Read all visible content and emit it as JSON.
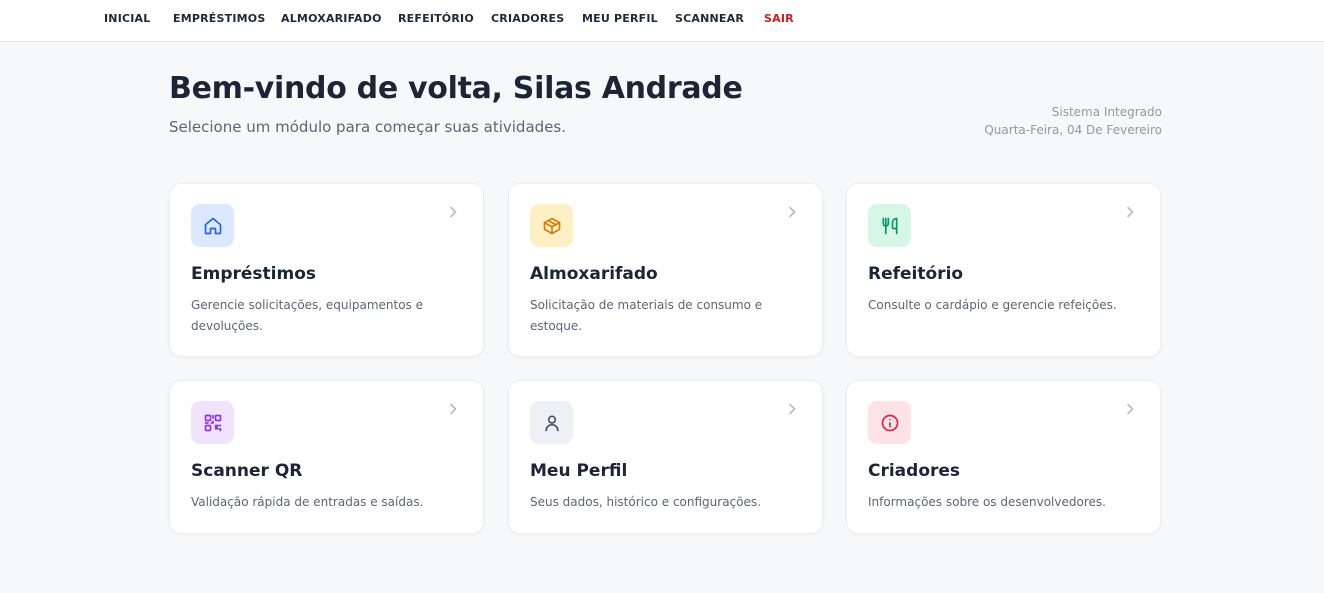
{
  "nav": {
    "items": [
      {
        "label": "INICIAL"
      },
      {
        "label": "EMPRÉSTIMOS"
      },
      {
        "label": "ALMOXARIFADO"
      },
      {
        "label": "REFEITÓRIO"
      },
      {
        "label": "CRIADORES"
      },
      {
        "label": "MEU PERFIL"
      },
      {
        "label": "SCANNEAR"
      }
    ],
    "logout_label": "SAIR",
    "logout_color": "#c81e1e"
  },
  "header": {
    "greeting": "Bem-vindo de volta, Silas Andrade",
    "subtitle": "Selecione um módulo para começar suas atividades.",
    "system_name": "Sistema Integrado",
    "date": "Quarta-Feira, 04 De Fevereiro"
  },
  "modules": [
    {
      "title": "Empréstimos",
      "description": "Gerencie solicitações, equipamentos e devoluções.",
      "icon": "home-icon",
      "icon_bg": "#dbe8fe",
      "icon_color": "#2563eb"
    },
    {
      "title": "Almoxarifado",
      "description": "Solicitação de materiais de consumo e estoque.",
      "icon": "package-icon",
      "icon_bg": "#fdf0c4",
      "icon_color": "#d97706"
    },
    {
      "title": "Refeitório",
      "description": "Consulte o cardápio e gerencie refeições.",
      "icon": "utensils-icon",
      "icon_bg": "#d6f7e5",
      "icon_color": "#059669"
    },
    {
      "title": "Scanner QR",
      "description": "Validação rápida de entradas e saídas.",
      "icon": "qr-code-icon",
      "icon_bg": "#f2e3fd",
      "icon_color": "#9333ea"
    },
    {
      "title": "Meu Perfil",
      "description": "Seus dados, histórico e configurações.",
      "icon": "user-icon",
      "icon_bg": "#eef0f5",
      "icon_color": "#475569"
    },
    {
      "title": "Criadores",
      "description": "Informações sobre os desenvolvedores.",
      "icon": "info-icon",
      "icon_bg": "#fde2e6",
      "icon_color": "#e11d48"
    }
  ]
}
